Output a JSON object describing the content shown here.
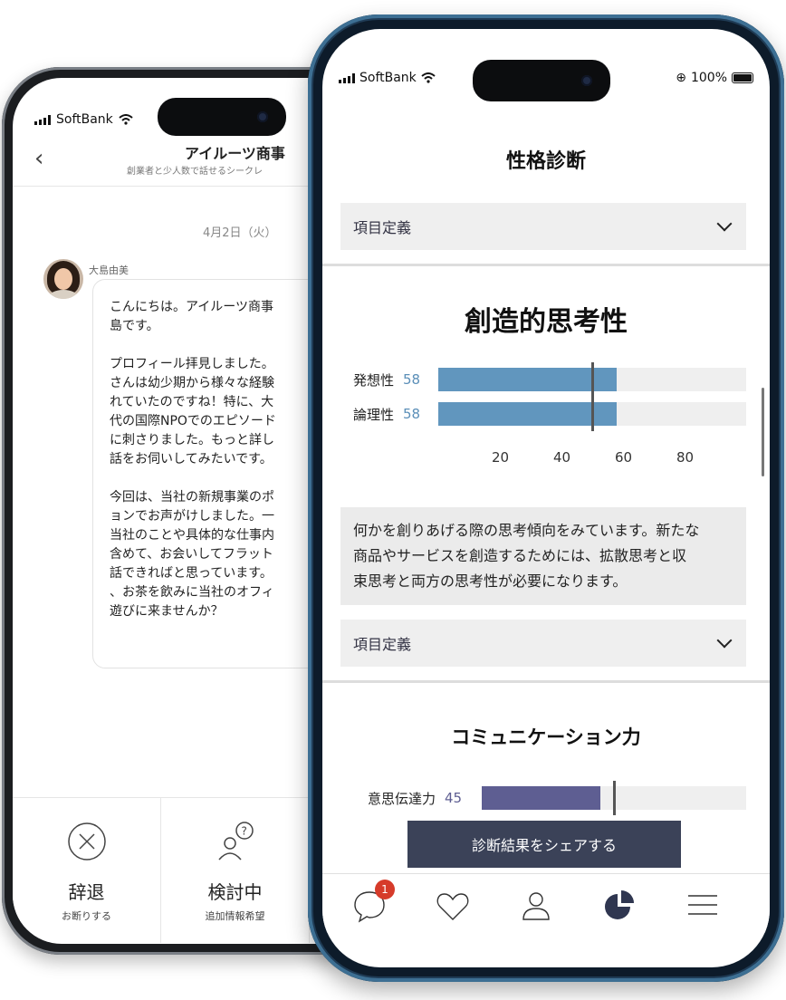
{
  "back_phone": {
    "status": {
      "carrier": "SoftBank"
    },
    "header": {
      "title": "アイルーツ商事",
      "subtitle": "創業者と少人数で話せるシークレ"
    },
    "date_label": "4月2日（火）",
    "message": {
      "sender": "大島由美",
      "paragraphs": [
        "こんにちは。アイルーツ商事\n島です。",
        "プロフィール拝見しました。\nさんは幼少期から様々な経験\nれていたのですね！特に、大\n代の国際NPOでのエピソード\nに刺さりました。もっと詳し\n話をお伺いしてみたいです。",
        "今回は、当社の新規事業のポ\nョンでお声がけしました。一\n当社のことや具体的な仕事内\n含めて、お会いしてフラット\n話できればと思っています。\n、お茶を飲みに当社のオフィ\n遊びに来ませんか？"
      ]
    },
    "actions": [
      {
        "label": "辞退",
        "sub": "お断りする",
        "icon": "decline-x-icon"
      },
      {
        "label": "検討中",
        "sub": "追加情報希望",
        "icon": "person-question-icon"
      }
    ]
  },
  "front_phone": {
    "status": {
      "carrier": "SoftBank",
      "battery": "100%"
    },
    "page_title": "性格診断",
    "accordion_label": "項目定義",
    "sections": [
      {
        "title": "創造的思考性",
        "description": "何かを創りあげる際の思考傾向をみています。新たな\n商品やサービスを創造するためには、拡散思考と収\n束思考と両方の思考性が必要になります。"
      },
      {
        "title": "コミュニケーション力"
      }
    ],
    "share_button": "診断結果をシェアする",
    "tabbar": {
      "items": [
        "messages-icon",
        "heart-icon",
        "profile-icon",
        "pie-chart-icon",
        "menu-icon"
      ],
      "badge": "1"
    }
  },
  "chart_data": [
    {
      "type": "bar",
      "orientation": "horizontal",
      "categories": [
        "発想性",
        "論理性"
      ],
      "values": [
        58,
        58
      ],
      "xticks": [
        20,
        40,
        60,
        80
      ],
      "xlim": [
        0,
        100
      ],
      "reference_value": 50,
      "colors": {
        "bar": "#6196be",
        "track": "#efefef",
        "value_text": "#5b8fb8"
      }
    },
    {
      "type": "bar",
      "orientation": "horizontal",
      "categories": [
        "意思伝達力"
      ],
      "values": [
        45
      ],
      "xlim": [
        0,
        100
      ],
      "reference_value": 50,
      "colors": {
        "bar": "#5e5e92",
        "track": "#efefef",
        "value_text": "#5e5e92"
      }
    }
  ]
}
